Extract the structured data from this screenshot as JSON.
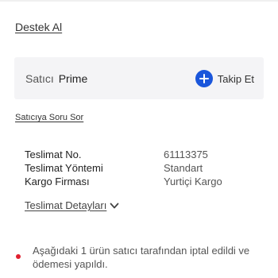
{
  "support": {
    "link_label": "Destek Al"
  },
  "seller": {
    "prefix": "Satıcı",
    "name": "Prime",
    "follow_label": "Takip Et",
    "accent_color": "#1a56db"
  },
  "ask_seller": {
    "link_label": "Satıcıya Soru Sor"
  },
  "shipping": {
    "rows": [
      {
        "label": "Teslimat No.",
        "value": "61113375"
      },
      {
        "label": "Teslimat Yöntemi",
        "value": "Standart"
      },
      {
        "label": "Kargo Firması",
        "value": "Yurtiçi Kargo"
      }
    ],
    "details_link_label": "Teslimat Detayları"
  },
  "cancel_note": {
    "text": "Aşağıdaki 1 ürün satıcı tarafından iptal edildi ve ödemesi yapıldı.",
    "dot_color": "#e0202f"
  }
}
